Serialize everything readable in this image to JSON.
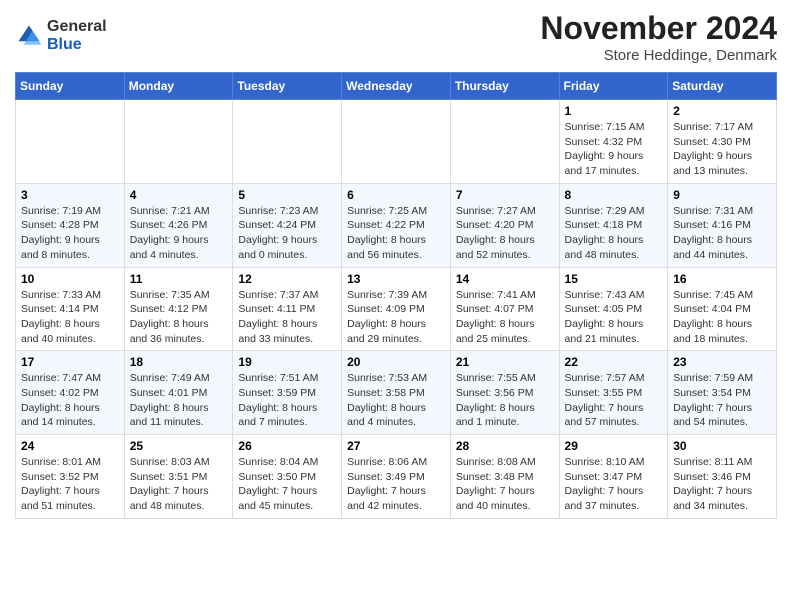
{
  "logo": {
    "general": "General",
    "blue": "Blue"
  },
  "header": {
    "month": "November 2024",
    "location": "Store Heddinge, Denmark"
  },
  "weekdays": [
    "Sunday",
    "Monday",
    "Tuesday",
    "Wednesday",
    "Thursday",
    "Friday",
    "Saturday"
  ],
  "weeks": [
    [
      {
        "day": "",
        "info": ""
      },
      {
        "day": "",
        "info": ""
      },
      {
        "day": "",
        "info": ""
      },
      {
        "day": "",
        "info": ""
      },
      {
        "day": "",
        "info": ""
      },
      {
        "day": "1",
        "info": "Sunrise: 7:15 AM\nSunset: 4:32 PM\nDaylight: 9 hours and 17 minutes."
      },
      {
        "day": "2",
        "info": "Sunrise: 7:17 AM\nSunset: 4:30 PM\nDaylight: 9 hours and 13 minutes."
      }
    ],
    [
      {
        "day": "3",
        "info": "Sunrise: 7:19 AM\nSunset: 4:28 PM\nDaylight: 9 hours and 8 minutes."
      },
      {
        "day": "4",
        "info": "Sunrise: 7:21 AM\nSunset: 4:26 PM\nDaylight: 9 hours and 4 minutes."
      },
      {
        "day": "5",
        "info": "Sunrise: 7:23 AM\nSunset: 4:24 PM\nDaylight: 9 hours and 0 minutes."
      },
      {
        "day": "6",
        "info": "Sunrise: 7:25 AM\nSunset: 4:22 PM\nDaylight: 8 hours and 56 minutes."
      },
      {
        "day": "7",
        "info": "Sunrise: 7:27 AM\nSunset: 4:20 PM\nDaylight: 8 hours and 52 minutes."
      },
      {
        "day": "8",
        "info": "Sunrise: 7:29 AM\nSunset: 4:18 PM\nDaylight: 8 hours and 48 minutes."
      },
      {
        "day": "9",
        "info": "Sunrise: 7:31 AM\nSunset: 4:16 PM\nDaylight: 8 hours and 44 minutes."
      }
    ],
    [
      {
        "day": "10",
        "info": "Sunrise: 7:33 AM\nSunset: 4:14 PM\nDaylight: 8 hours and 40 minutes."
      },
      {
        "day": "11",
        "info": "Sunrise: 7:35 AM\nSunset: 4:12 PM\nDaylight: 8 hours and 36 minutes."
      },
      {
        "day": "12",
        "info": "Sunrise: 7:37 AM\nSunset: 4:11 PM\nDaylight: 8 hours and 33 minutes."
      },
      {
        "day": "13",
        "info": "Sunrise: 7:39 AM\nSunset: 4:09 PM\nDaylight: 8 hours and 29 minutes."
      },
      {
        "day": "14",
        "info": "Sunrise: 7:41 AM\nSunset: 4:07 PM\nDaylight: 8 hours and 25 minutes."
      },
      {
        "day": "15",
        "info": "Sunrise: 7:43 AM\nSunset: 4:05 PM\nDaylight: 8 hours and 21 minutes."
      },
      {
        "day": "16",
        "info": "Sunrise: 7:45 AM\nSunset: 4:04 PM\nDaylight: 8 hours and 18 minutes."
      }
    ],
    [
      {
        "day": "17",
        "info": "Sunrise: 7:47 AM\nSunset: 4:02 PM\nDaylight: 8 hours and 14 minutes."
      },
      {
        "day": "18",
        "info": "Sunrise: 7:49 AM\nSunset: 4:01 PM\nDaylight: 8 hours and 11 minutes."
      },
      {
        "day": "19",
        "info": "Sunrise: 7:51 AM\nSunset: 3:59 PM\nDaylight: 8 hours and 7 minutes."
      },
      {
        "day": "20",
        "info": "Sunrise: 7:53 AM\nSunset: 3:58 PM\nDaylight: 8 hours and 4 minutes."
      },
      {
        "day": "21",
        "info": "Sunrise: 7:55 AM\nSunset: 3:56 PM\nDaylight: 8 hours and 1 minute."
      },
      {
        "day": "22",
        "info": "Sunrise: 7:57 AM\nSunset: 3:55 PM\nDaylight: 7 hours and 57 minutes."
      },
      {
        "day": "23",
        "info": "Sunrise: 7:59 AM\nSunset: 3:54 PM\nDaylight: 7 hours and 54 minutes."
      }
    ],
    [
      {
        "day": "24",
        "info": "Sunrise: 8:01 AM\nSunset: 3:52 PM\nDaylight: 7 hours and 51 minutes."
      },
      {
        "day": "25",
        "info": "Sunrise: 8:03 AM\nSunset: 3:51 PM\nDaylight: 7 hours and 48 minutes."
      },
      {
        "day": "26",
        "info": "Sunrise: 8:04 AM\nSunset: 3:50 PM\nDaylight: 7 hours and 45 minutes."
      },
      {
        "day": "27",
        "info": "Sunrise: 8:06 AM\nSunset: 3:49 PM\nDaylight: 7 hours and 42 minutes."
      },
      {
        "day": "28",
        "info": "Sunrise: 8:08 AM\nSunset: 3:48 PM\nDaylight: 7 hours and 40 minutes."
      },
      {
        "day": "29",
        "info": "Sunrise: 8:10 AM\nSunset: 3:47 PM\nDaylight: 7 hours and 37 minutes."
      },
      {
        "day": "30",
        "info": "Sunrise: 8:11 AM\nSunset: 3:46 PM\nDaylight: 7 hours and 34 minutes."
      }
    ]
  ]
}
